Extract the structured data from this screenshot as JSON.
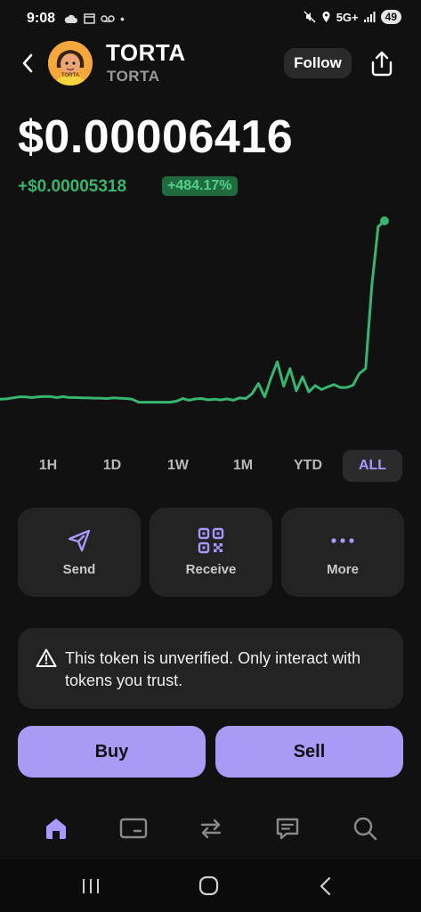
{
  "status_bar": {
    "time": "9:08",
    "network": "5G+",
    "battery": "49"
  },
  "header": {
    "token_name": "TORTA",
    "token_symbol": "TORTA",
    "avatar_label": "TORTA",
    "follow_label": "Follow"
  },
  "price": {
    "current": "$0.00006416",
    "change": "+$0.00005318",
    "change_percent": "+484.17%"
  },
  "colors": {
    "accent": "#a99bf5",
    "positive": "#38b56f",
    "background": "#111111",
    "card": "#232323"
  },
  "chart_data": {
    "type": "line",
    "title": "",
    "xlabel": "",
    "ylabel": "",
    "grid": false,
    "series": [
      {
        "values": [
          1.08e-05,
          1.09e-05,
          1.12e-05,
          1.15e-05,
          1.15e-05,
          1.13e-05,
          1.15e-05,
          1.16e-05,
          1.16e-05,
          1.13e-05,
          1.16e-05,
          1.13e-05,
          1.13e-05,
          1.12e-05,
          1.12e-05,
          1.11e-05,
          1.11e-05,
          1.1e-05,
          1.12e-05,
          1.11e-05,
          1.1e-05,
          1.08e-05,
          9.9e-06,
          9.9e-06,
          9.9e-06,
          9.9e-06,
          9.9e-06,
          9.9e-06,
          1.02e-05,
          1.1e-05,
          1.05e-05,
          1.09e-05,
          1.1e-05,
          1.06e-05,
          1.08e-05,
          1.06e-05,
          1.09e-05,
          1.05e-05,
          1.12e-05,
          1.1e-05,
          1.25e-05,
          1.55e-05,
          1.15e-05,
          1.72e-05,
          2.2e-05,
          1.47e-05,
          2e-05,
          1.33e-05,
          1.75e-05,
          1.3e-05,
          1.49e-05,
          1.37e-05,
          1.45e-05,
          1.52e-05,
          1.43e-05,
          1.43e-05,
          1.5e-05,
          1.85e-05,
          2e-05,
          4.5e-05,
          6.25e-05,
          6.42e-05
        ]
      }
    ],
    "ylim": [
      5e-06,
      6.5e-05
    ]
  },
  "range_tabs": [
    "1H",
    "1D",
    "1W",
    "1M",
    "YTD",
    "ALL"
  ],
  "active_range": "ALL",
  "actions": [
    {
      "label": "Send",
      "icon": "send-icon"
    },
    {
      "label": "Receive",
      "icon": "qr-code-icon"
    },
    {
      "label": "More",
      "icon": "more-dots-icon"
    }
  ],
  "warning": {
    "text": "This token is unverified. Only interact with tokens you trust."
  },
  "trade": {
    "buy_label": "Buy",
    "sell_label": "Sell"
  },
  "tabbar": {
    "items": [
      "home-icon",
      "wallet-card-icon",
      "swap-icon",
      "chat-icon",
      "search-icon"
    ],
    "active": "home-icon"
  }
}
